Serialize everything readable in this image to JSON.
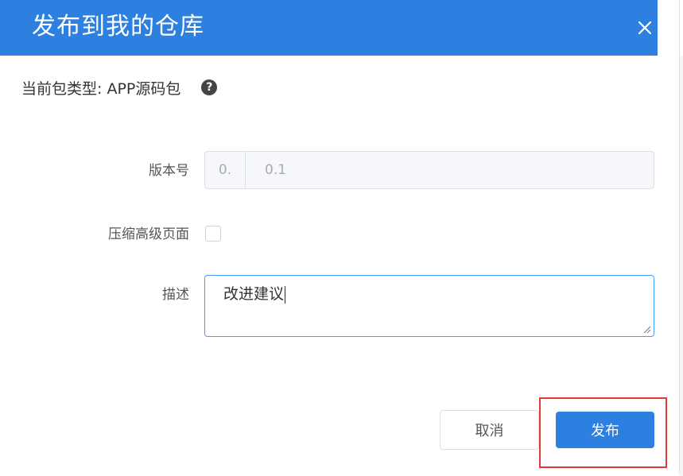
{
  "dialog": {
    "title": "发布到我的仓库",
    "close_icon": "close-icon"
  },
  "package": {
    "type_label": "当前包类型: APP源码包",
    "help_icon": "question-circle-icon",
    "help_glyph": "?"
  },
  "form": {
    "version": {
      "label": "版本号",
      "prefix": "0.",
      "value": "0.1"
    },
    "compress": {
      "label": "压缩高级页面",
      "checked": false
    },
    "description": {
      "label": "描述",
      "value": "改进建议"
    }
  },
  "actions": {
    "cancel_label": "取消",
    "publish_label": "发布"
  },
  "colors": {
    "header": "#2d7fe0",
    "primary": "#2d7fe0",
    "focus_border": "#409eff",
    "highlight": "#e53935"
  }
}
